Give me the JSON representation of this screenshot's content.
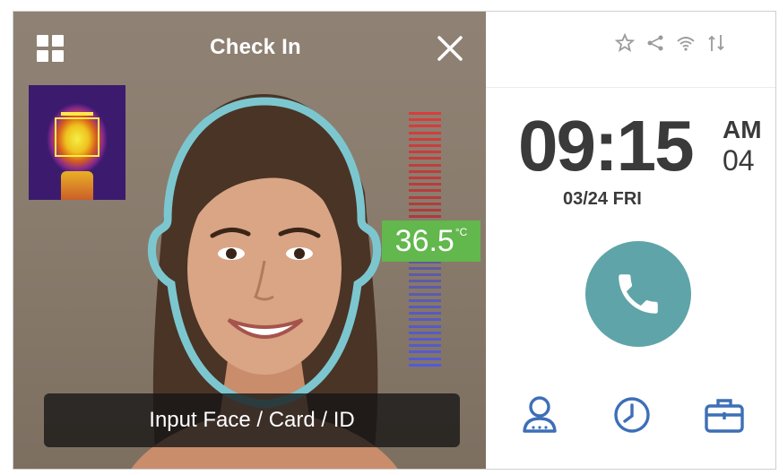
{
  "camera": {
    "title": "Check In",
    "temperature": "36.5",
    "temperature_unit": "°C",
    "prompt": "Input Face / Card / ID"
  },
  "status": {
    "icons": [
      "star-icon",
      "share-icon",
      "wifi-icon",
      "network-icon"
    ]
  },
  "clock": {
    "hour_minute": "09:15",
    "ampm": "AM",
    "seconds": "04",
    "date": "03/24 FRI"
  },
  "actions": {
    "call_icon": "phone-icon",
    "bottom": [
      "user-icon",
      "clock-icon",
      "briefcase-icon"
    ]
  },
  "colors": {
    "accent": "#5fa4a8",
    "temperature_ok": "#62b74d",
    "face_outline": "#7cc7cf",
    "icon_blue": "#3d6fb7"
  }
}
